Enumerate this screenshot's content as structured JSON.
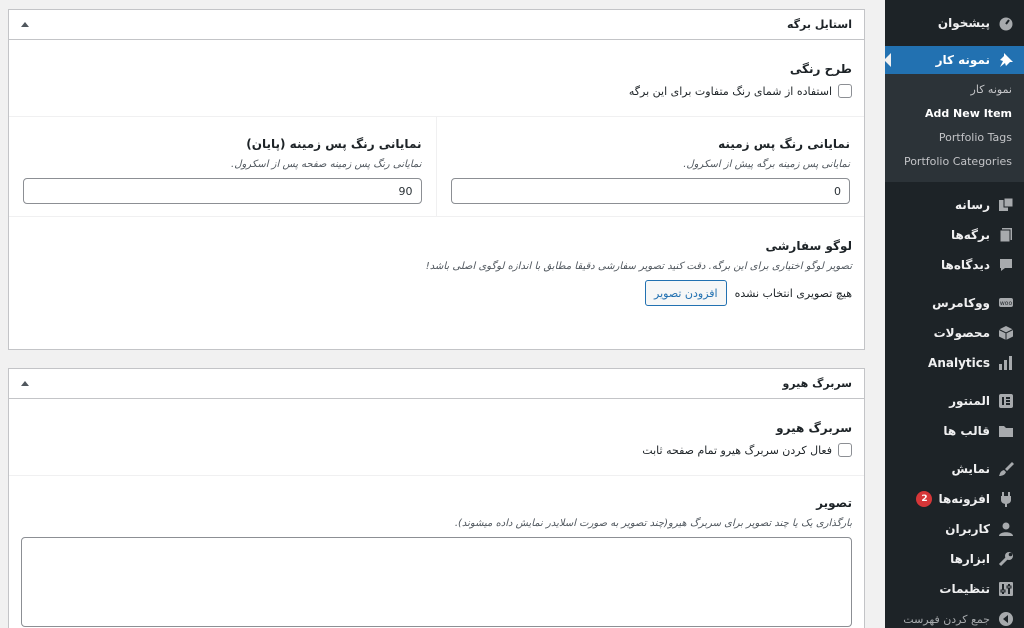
{
  "sidebar": {
    "items_top": [
      {
        "label": "پیشخوان",
        "icon": "dashboard-icon"
      }
    ],
    "current": {
      "label": "نمونه کار",
      "icon": "pin-icon"
    },
    "submenu": [
      {
        "label": "نمونه کار"
      },
      {
        "label": "Add New Item"
      },
      {
        "label": "Portfolio Tags"
      },
      {
        "label": "Portfolio Categories"
      }
    ],
    "items_group1": [
      {
        "label": "رسانه",
        "icon": "media-icon"
      },
      {
        "label": "برگه‌ها",
        "icon": "pages-icon"
      },
      {
        "label": "دیدگاه‌ها",
        "icon": "comments-icon"
      }
    ],
    "items_group2": [
      {
        "label": "ووکامرس",
        "icon": "woocommerce-icon"
      },
      {
        "label": "محصولات",
        "icon": "products-icon"
      },
      {
        "label": "Analytics",
        "icon": "analytics-icon"
      }
    ],
    "items_group3": [
      {
        "label": "المنتور",
        "icon": "elementor-icon"
      },
      {
        "label": "قالب ها",
        "icon": "templates-folder-icon"
      }
    ],
    "items_group4": [
      {
        "label": "نمایش",
        "icon": "appearance-icon"
      },
      {
        "label": "افزونه‌ها",
        "icon": "plugins-icon",
        "badge": "2"
      },
      {
        "label": "کاربران",
        "icon": "users-icon"
      },
      {
        "label": "ابزارها",
        "icon": "tools-icon"
      },
      {
        "label": "تنظیمات",
        "icon": "settings-icon"
      },
      {
        "label": "جمع کردن فهرست",
        "icon": "collapse-icon"
      }
    ]
  },
  "page_style": {
    "title": "استایل برگه",
    "color_scheme": {
      "title": "طرح رنگی",
      "checkbox_label": "استفاده از شمای رنگ متفاوت برای این برگه"
    },
    "bg_visibility": {
      "title": "نمایانی رنگ پس زمینه",
      "desc": "نمایانی پس زمینه برگه پیش از اسکرول.",
      "value": "0"
    },
    "bg_visibility_end": {
      "title": "نمایانی رنگ پس زمینه (پایان)",
      "desc": "نمایانی رنگ پس زمینه صفحه پس از اسکرول.",
      "value": "90"
    },
    "custom_logo": {
      "title": "لوگو سفارشی",
      "desc": "تصویر لوگو اختیاری برای این برگه. دقت کنید تصویر سفارشی دقیقا مطابق با اندازه لوگوی اصلی باشد!",
      "add_button": "افزودن تصویر",
      "no_image": "هیچ تصویری انتخاب نشده"
    }
  },
  "hero": {
    "title": "سربرگ هیرو",
    "hero_field": {
      "title": "سربرگ هیرو",
      "checkbox_label": "فعال کردن سربرگ هیرو تمام صفحه ثابت"
    },
    "image_field": {
      "title": "تصویر",
      "desc": "بارگذاری یک یا چند تصویر برای سربرگ هیرو(چند تصویر به صورت اسلایدر نمایش داده میشوند)."
    }
  }
}
